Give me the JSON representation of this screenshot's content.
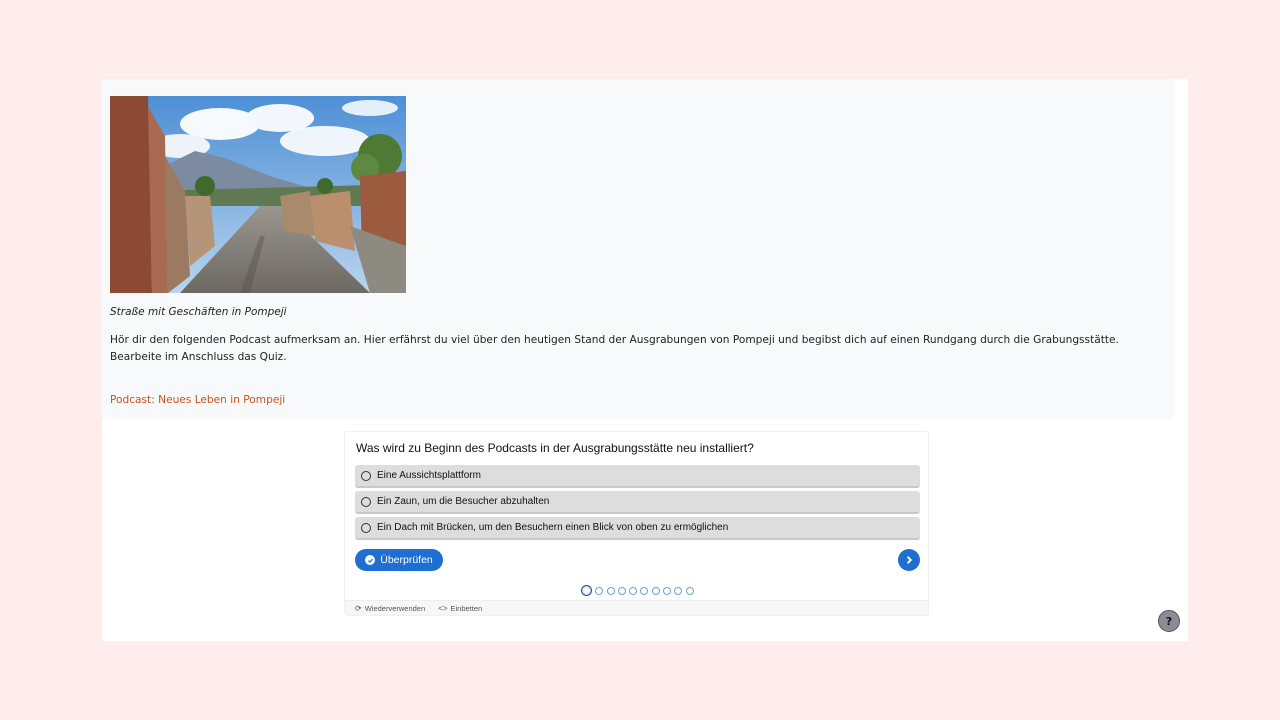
{
  "content": {
    "image_alt": "Straße mit Geschäften in Pompeji",
    "caption": "Straße mit Geschäften in Pompeji",
    "intro": "Hör dir den folgenden Podcast aufmerksam an. Hier erfährst du viel über den heutigen Stand der Ausgrabungen von Pompeji und begibst dich auf einen Rundgang durch die Grabungsstätte. Bearbeite im Anschluss das Quiz.",
    "podcast_link": "Podcast: Neues Leben in Pompeji"
  },
  "quiz": {
    "question": "Was wird zu Beginn des Podcasts in der Ausgrabungsstätte neu installiert?",
    "answers": [
      {
        "label": "Eine Aussichtsplattform"
      },
      {
        "label": "Ein Zaun, um die Besucher abzuhalten"
      },
      {
        "label": "Ein Dach mit Brücken, um den Besuchern einen Blick von oben zu ermöglichen"
      }
    ],
    "check_label": "Überprüfen",
    "progress": {
      "total": 10,
      "current": 1
    },
    "footer": {
      "reuse_label": "Wiederverwenden",
      "embed_label": "Einbetten"
    }
  },
  "help_label": "?",
  "colors": {
    "background": "#ffeded",
    "accent": "#1f6fd1",
    "link": "#c9531d",
    "answer_bg": "#dddddd"
  }
}
